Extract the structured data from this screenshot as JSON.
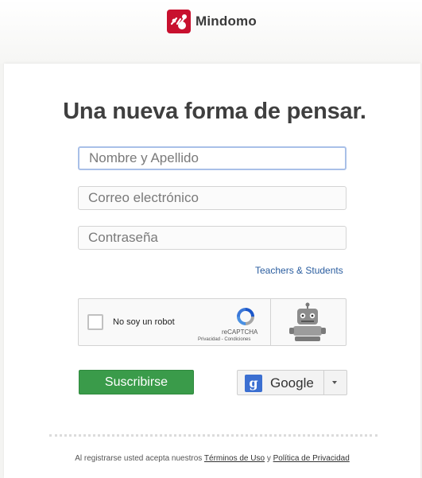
{
  "brand": {
    "name": "Mindomo",
    "color": "#c8102e"
  },
  "headline": "Una nueva forma de pensar.",
  "form": {
    "name_placeholder": "Nombre y Apellido",
    "email_placeholder": "Correo electrónico",
    "password_placeholder": "Contraseña",
    "teachers_link": "Teachers & Students"
  },
  "captcha": {
    "checkbox_label": "No soy un robot",
    "brand": "reCAPTCHA",
    "links": "Privacidad - Condiciones"
  },
  "buttons": {
    "subscribe": "Suscribirse",
    "google": "Google",
    "google_icon_glyph": "g"
  },
  "footer": {
    "prefix": "Al registrarse usted acepta nuestros",
    "terms": "Términos de Uso",
    "conjunction": "y",
    "privacy": "Política de Privacidad"
  },
  "colors": {
    "subscribe_green": "#3a9b4a",
    "google_blue": "#3b6fd1",
    "link_blue": "#2a5d9f"
  }
}
